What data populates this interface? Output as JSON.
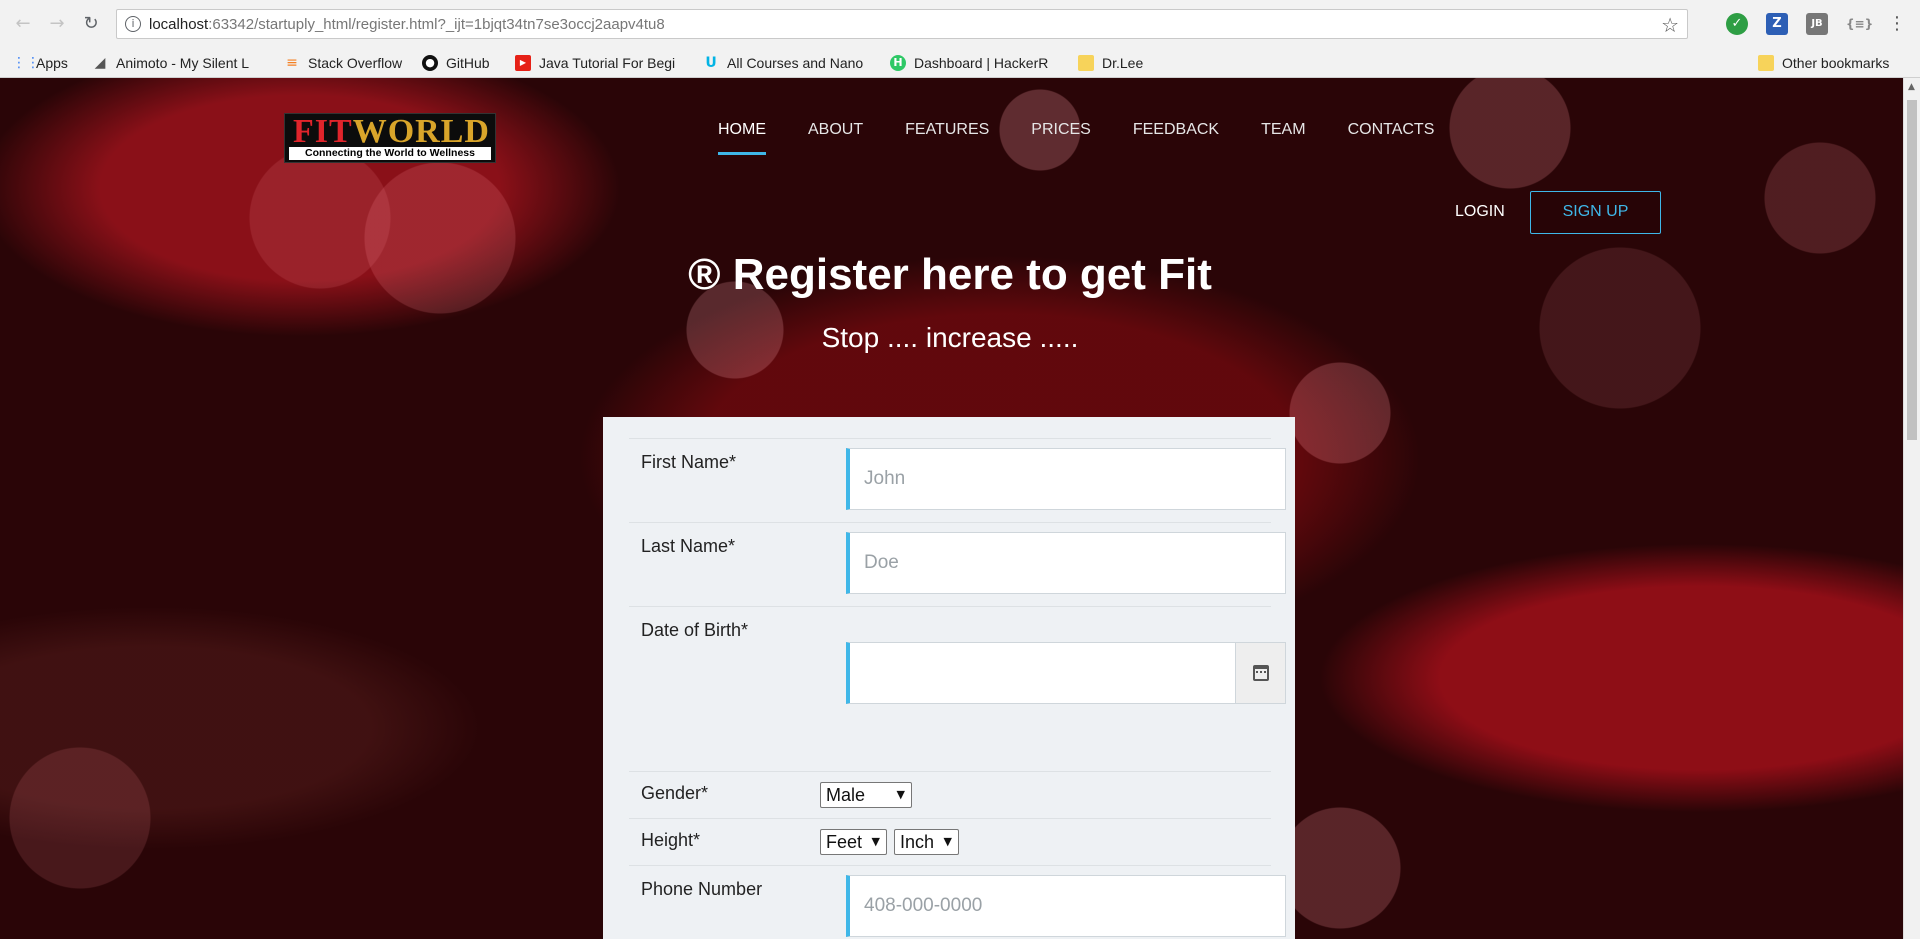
{
  "browser": {
    "url_host": "localhost",
    "url_rest": ":63342/startuply_html/register.html?_ijt=1bjqt34tn7se3occj2aapv4tu8",
    "bookmarks": [
      {
        "label": "Apps",
        "icon": "apps-grid-icon",
        "color": "#4285f4"
      },
      {
        "label": "Animoto - My Silent L",
        "icon": "animoto-icon",
        "color": "#555555"
      },
      {
        "label": "Stack Overflow",
        "icon": "stackoverflow-icon",
        "color": "#f48024"
      },
      {
        "label": "GitHub",
        "icon": "github-icon",
        "color": "#111111"
      },
      {
        "label": "Java Tutorial For Begi",
        "icon": "youtube-icon",
        "color": "#e62117"
      },
      {
        "label": "All Courses and Nano",
        "icon": "udacity-icon",
        "color": "#02b3e4"
      },
      {
        "label": "Dashboard | HackerR",
        "icon": "hackerrank-icon",
        "color": "#2ec866"
      },
      {
        "label": "Dr.Lee",
        "icon": "folder-icon",
        "color": "#f7d35a"
      }
    ],
    "other_bookmarks": "Other bookmarks"
  },
  "site": {
    "logo_fit": "FIT",
    "logo_world": "WORLD",
    "logo_tagline": "Connecting the World to Wellness",
    "nav": [
      "HOME",
      "ABOUT",
      "FEATURES",
      "PRICES",
      "FEEDBACK",
      "TEAM",
      "CONTACTS"
    ],
    "active_nav": "HOME",
    "login": "LOGIN",
    "signup": "SIGN UP",
    "accent_color": "#3fb7e8"
  },
  "hero": {
    "title": "® Register here to get Fit",
    "subtitle": "Stop .... increase ....."
  },
  "form": {
    "first_name": {
      "label": "First Name*",
      "placeholder": "John"
    },
    "last_name": {
      "label": "Last Name*",
      "placeholder": "Doe"
    },
    "dob": {
      "label": "Date of Birth*",
      "value": ""
    },
    "gender": {
      "label": "Gender*",
      "value": "Male"
    },
    "height": {
      "label": "Height*",
      "feet": "Feet",
      "inch": "Inch"
    },
    "phone": {
      "label": "Phone Number",
      "placeholder": "408-000-0000"
    }
  }
}
